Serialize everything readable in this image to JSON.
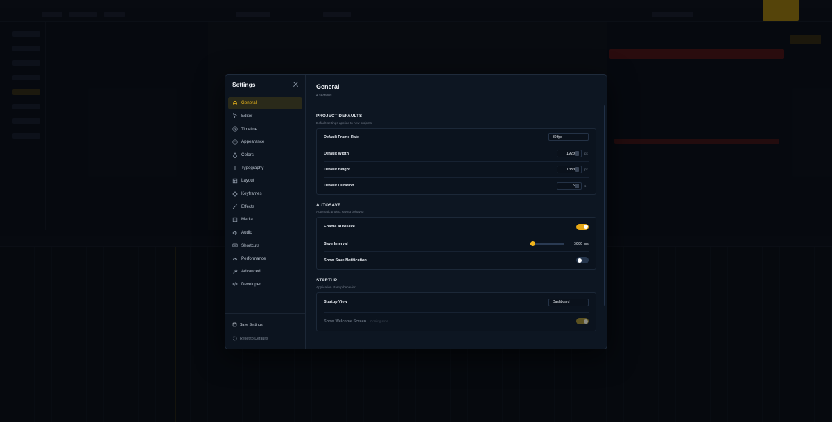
{
  "settings": {
    "title": "Settings",
    "nav": [
      {
        "label": "General",
        "icon": "gear-icon",
        "active": true
      },
      {
        "label": "Editor",
        "icon": "cursor-icon"
      },
      {
        "label": "Timeline",
        "icon": "clock-icon"
      },
      {
        "label": "Appearance",
        "icon": "palette-icon"
      },
      {
        "label": "Colors",
        "icon": "droplet-icon"
      },
      {
        "label": "Typography",
        "icon": "type-icon"
      },
      {
        "label": "Layout",
        "icon": "layout-icon"
      },
      {
        "label": "Keyframes",
        "icon": "diamond-icon"
      },
      {
        "label": "Effects",
        "icon": "wand-icon"
      },
      {
        "label": "Media",
        "icon": "film-icon"
      },
      {
        "label": "Audio",
        "icon": "speaker-icon"
      },
      {
        "label": "Shortcuts",
        "icon": "keyboard-icon"
      },
      {
        "label": "Performance",
        "icon": "gauge-icon"
      },
      {
        "label": "Advanced",
        "icon": "wrench-icon"
      },
      {
        "label": "Developer",
        "icon": "code-icon"
      }
    ],
    "save_label": "Save Settings",
    "reset_label": "Reset to Defaults"
  },
  "page": {
    "title": "General",
    "subtitle": "4 sections"
  },
  "sections": {
    "project": {
      "title": "PROJECT DEFAULTS",
      "desc": "Default settings applied to new projects",
      "frame_rate_label": "Default Frame Rate",
      "frame_rate_value": "30 fps",
      "width_label": "Default Width",
      "width_value": "1920",
      "width_unit": "px",
      "height_label": "Default Height",
      "height_value": "1080",
      "height_unit": "px",
      "duration_label": "Default Duration",
      "duration_value": "5",
      "duration_unit": "s"
    },
    "autosave": {
      "title": "AUTOSAVE",
      "desc": "Automatic project saving behavior",
      "enable_label": "Enable Autosave",
      "enable_on": true,
      "interval_label": "Save Interval",
      "interval_value": "3000 ms",
      "interval_fraction": 0.1,
      "notify_label": "Show Save Notification",
      "notify_on": false
    },
    "startup": {
      "title": "STARTUP",
      "desc": "Application startup behavior",
      "view_label": "Startup View",
      "view_value": "Dashboard",
      "welcome_label": "Show Welcome Screen",
      "welcome_hint": "Coming soon"
    }
  },
  "colors": {
    "accent": "#f0b91a",
    "panel": "#0d1622"
  }
}
